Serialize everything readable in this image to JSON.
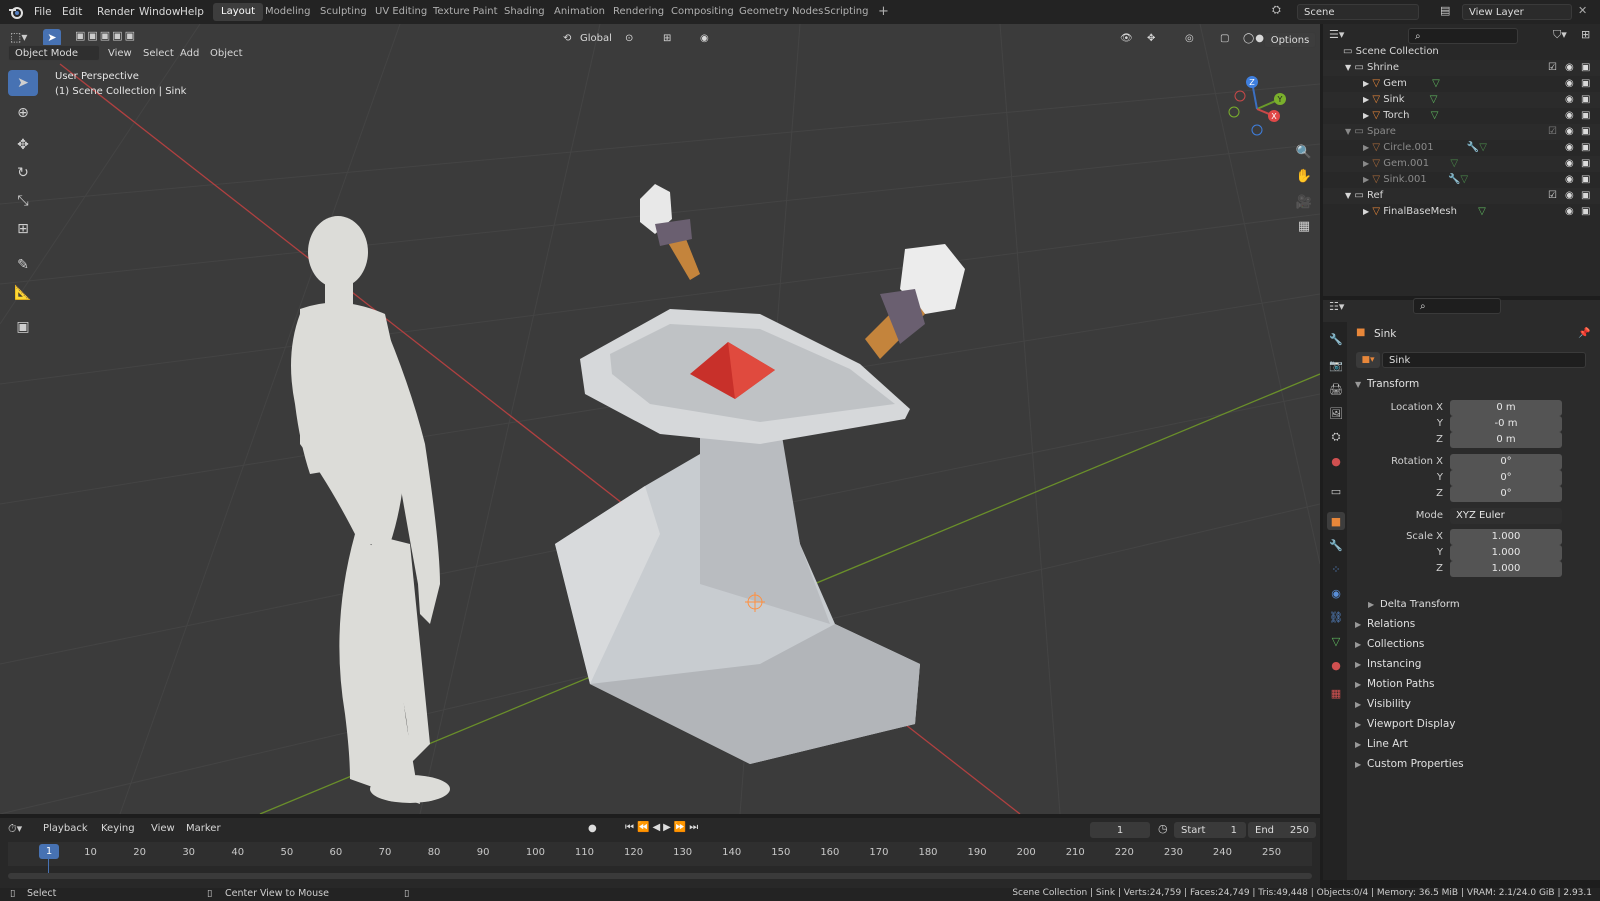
{
  "menu": [
    "File",
    "Edit",
    "Render",
    "Window",
    "Help"
  ],
  "workspaces": [
    "Layout",
    "Modeling",
    "Sculpting",
    "UV Editing",
    "Texture Paint",
    "Shading",
    "Animation",
    "Rendering",
    "Compositing",
    "Geometry Nodes",
    "Scripting"
  ],
  "add_tab_icon": "plus-icon",
  "scene": {
    "label": "Scene",
    "view_layer": "View Layer"
  },
  "viewport": {
    "mode": "Object Mode",
    "menus": [
      "View",
      "Select",
      "Add",
      "Object"
    ],
    "transform_orientation": "Global",
    "options_label": "Options",
    "overlay_line1": "User Perspective",
    "overlay_line2": "(1) Scene Collection | Sink",
    "gizmo_axes": {
      "x": "X",
      "y": "Y",
      "z": "Z"
    }
  },
  "outliner": {
    "root": "Scene Collection",
    "rows": [
      {
        "label": "Shrine",
        "kind": "collection"
      },
      {
        "label": "Gem",
        "kind": "object"
      },
      {
        "label": "Sink",
        "kind": "object"
      },
      {
        "label": "Torch",
        "kind": "object"
      },
      {
        "label": "Spare",
        "kind": "collection"
      },
      {
        "label": "Circle.001",
        "kind": "object"
      },
      {
        "label": "Gem.001",
        "kind": "object"
      },
      {
        "label": "Sink.001",
        "kind": "object"
      },
      {
        "label": "Ref",
        "kind": "collection"
      },
      {
        "label": "FinalBaseMesh",
        "kind": "object"
      }
    ]
  },
  "properties": {
    "object_name": "Sink",
    "name_field": "Sink",
    "transform_title": "Transform",
    "location": {
      "label_x": "Location X",
      "label_y": "Y",
      "label_z": "Z",
      "x": "0 m",
      "y": "-0 m",
      "z": "0 m"
    },
    "rotation": {
      "label_x": "Rotation X",
      "label_y": "Y",
      "label_z": "Z",
      "x": "0°",
      "y": "0°",
      "z": "0°"
    },
    "mode": {
      "label": "Mode",
      "value": "XYZ Euler"
    },
    "scale": {
      "label_x": "Scale X",
      "label_y": "Y",
      "label_z": "Z",
      "x": "1.000",
      "y": "1.000",
      "z": "1.000"
    },
    "delta": "Delta Transform",
    "panels": [
      "Relations",
      "Collections",
      "Instancing",
      "Motion Paths",
      "Visibility",
      "Viewport Display",
      "Line Art",
      "Custom Properties"
    ]
  },
  "timeline": {
    "menus": [
      "Playback",
      "Keying",
      "View",
      "Marker"
    ],
    "current_frame": "1",
    "start_label": "Start",
    "start": "1",
    "end_label": "End",
    "end": "250",
    "ticks": [
      "1",
      "10",
      "20",
      "30",
      "40",
      "50",
      "60",
      "70",
      "80",
      "90",
      "100",
      "110",
      "120",
      "130",
      "140",
      "150",
      "160",
      "170",
      "180",
      "190",
      "200",
      "210",
      "220",
      "230",
      "240",
      "250"
    ]
  },
  "status": {
    "left": "Select",
    "middle": "Center View to Mouse",
    "right": "Scene Collection | Sink | Verts:24,759 | Faces:24,749 | Tris:49,448 | Objects:0/4 | Memory: 36.5 MiB | VRAM: 2.1/24.0 GiB | 2.93.1"
  },
  "colors": {
    "accent": "#4772b3",
    "object_orange": "#e8873a",
    "mesh_green": "#5fb85f",
    "x_axis": "#c84848",
    "y_axis": "#7ab02c"
  }
}
